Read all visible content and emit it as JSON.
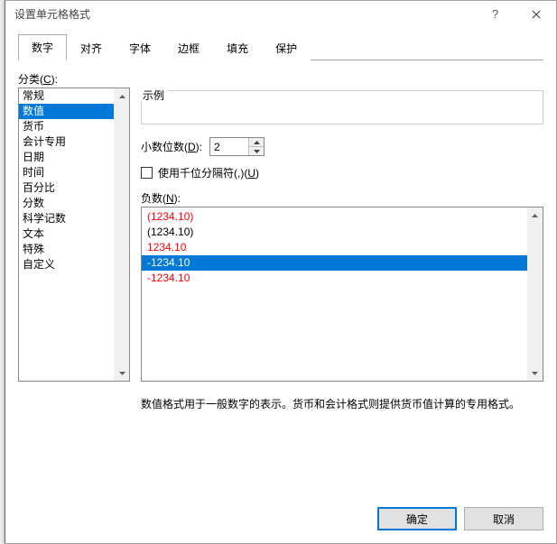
{
  "window": {
    "title": "设置单元格格式",
    "help_tooltip": "?",
    "close_tooltip": "关闭"
  },
  "tabs": [
    {
      "id": "number",
      "label": "数字",
      "active": true
    },
    {
      "id": "align",
      "label": "对齐",
      "active": false
    },
    {
      "id": "font",
      "label": "字体",
      "active": false
    },
    {
      "id": "border",
      "label": "边框",
      "active": false
    },
    {
      "id": "fill",
      "label": "填充",
      "active": false
    },
    {
      "id": "protect",
      "label": "保护",
      "active": false
    }
  ],
  "category": {
    "label_prefix": "分类(",
    "label_hotkey": "C",
    "label_suffix": "):",
    "items": [
      {
        "label": "常规",
        "selected": false
      },
      {
        "label": "数值",
        "selected": true
      },
      {
        "label": "货币",
        "selected": false
      },
      {
        "label": "会计专用",
        "selected": false
      },
      {
        "label": "日期",
        "selected": false
      },
      {
        "label": "时间",
        "selected": false
      },
      {
        "label": "百分比",
        "selected": false
      },
      {
        "label": "分数",
        "selected": false
      },
      {
        "label": "科学记数",
        "selected": false
      },
      {
        "label": "文本",
        "selected": false
      },
      {
        "label": "特殊",
        "selected": false
      },
      {
        "label": "自定义",
        "selected": false
      }
    ]
  },
  "sample": {
    "label": "示例",
    "value": ""
  },
  "decimal": {
    "label_prefix": "小数位数(",
    "label_hotkey": "D",
    "label_suffix": "):",
    "value": "2"
  },
  "thousands": {
    "checked": false,
    "label_prefix": "使用千位分隔符(,)(",
    "label_hotkey": "U",
    "label_suffix": ")"
  },
  "negative": {
    "label_prefix": "负数(",
    "label_hotkey": "N",
    "label_suffix": "):",
    "items": [
      {
        "text": "(1234.10)",
        "red": true,
        "selected": false
      },
      {
        "text": "(1234.10)",
        "red": false,
        "selected": false
      },
      {
        "text": "1234.10",
        "red": true,
        "selected": false
      },
      {
        "text": "-1234.10",
        "red": false,
        "selected": true
      },
      {
        "text": "-1234.10",
        "red": true,
        "selected": false
      }
    ]
  },
  "description": "数值格式用于一般数字的表示。货币和会计格式则提供货币值计算的专用格式。",
  "buttons": {
    "ok": "确定",
    "cancel": "取消"
  }
}
